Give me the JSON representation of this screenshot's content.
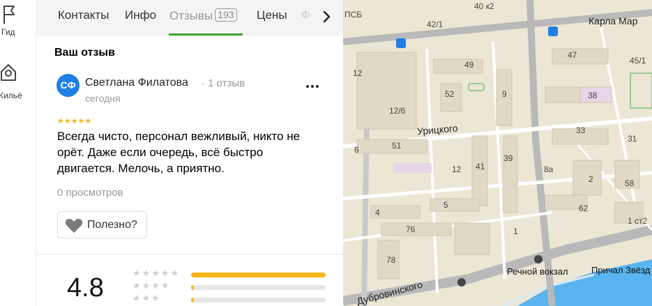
{
  "nav": {
    "guide_label": "Гид",
    "housing_label": "Жильё"
  },
  "tabs": [
    {
      "label": "Контакты"
    },
    {
      "label": "Инфо"
    },
    {
      "label": "Отзывы",
      "count": "193",
      "active": true
    },
    {
      "label": "Цены"
    },
    {
      "label": "Ф"
    }
  ],
  "review": {
    "section_title": "Ваш отзыв",
    "avatar_initials": "СФ",
    "author": "Светлана Филатова",
    "author_meta": "· 1 отзыв",
    "date": "сегодня",
    "stars": 5,
    "text": "Всегда чисто, персонал вежливый, никто не орёт. Даже если очередь, всё быстро двигается. Мелочь, а приятно.",
    "views": "0 просмотров",
    "useful_label": "Полезно?"
  },
  "rating": {
    "value": "4.8",
    "breakdown": [
      {
        "stars": 5,
        "fraction": 1.0
      },
      {
        "stars": 4,
        "fraction": 0.02
      },
      {
        "stars": 3,
        "fraction": 0.02
      }
    ]
  },
  "map": {
    "streets": [
      "Карла Мар",
      "Урицкого",
      "Дубровинского"
    ],
    "pois": [
      "Речной вокзал",
      "Причал Звёзд"
    ],
    "house_numbers": [
      "40 к2",
      "42/1",
      "12",
      "49",
      "47",
      "45/1",
      "52",
      "9",
      "38",
      "12/6",
      "33",
      "51",
      "31",
      "6",
      "12",
      "41",
      "39",
      "8а",
      "2",
      "58",
      "5",
      "62",
      "4",
      "76",
      "1",
      "1 ст2",
      "78"
    ],
    "partial_label": "ПСБ",
    "colors": {
      "land": "#ece6d4",
      "building": "#e0d9c6",
      "road": "#ffffff",
      "major_road": "#b9b9b9",
      "water": "#59b4f0"
    }
  }
}
